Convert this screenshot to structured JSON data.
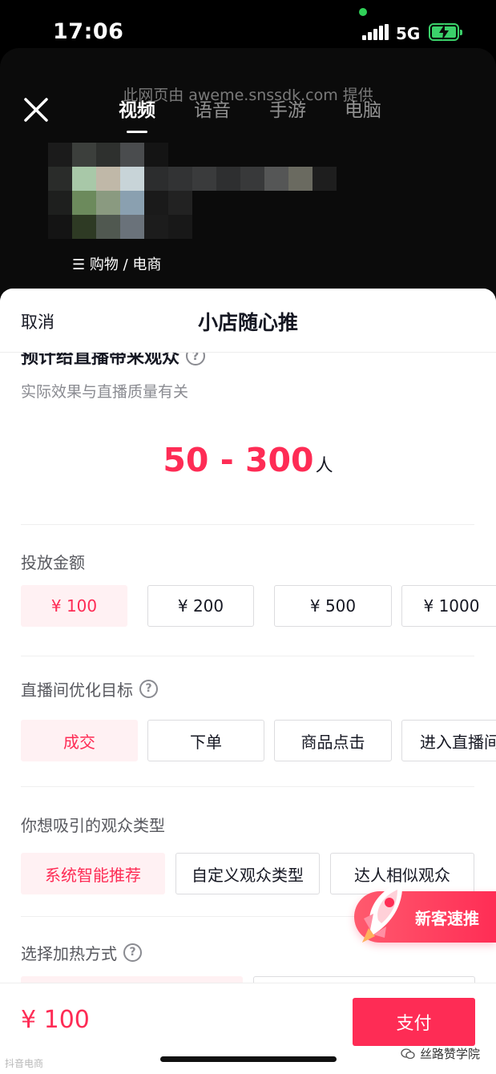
{
  "status_bar": {
    "time": "17:06",
    "network": "5G"
  },
  "header": {
    "provider": "此网页由 aweme.snssdk.com 提供",
    "tabs": [
      {
        "label": "视频",
        "active": true
      },
      {
        "label": "语音",
        "active": false
      },
      {
        "label": "手游",
        "active": false
      },
      {
        "label": "电脑",
        "active": false
      }
    ],
    "category": "☰ 购物 / 电商"
  },
  "sheet": {
    "cancel_label": "取消",
    "title": "小店随心推",
    "estimate": {
      "label": "预计给直播带来观众",
      "sub": "实际效果与直播质量有关",
      "value": "50 - 300",
      "unit": "人"
    },
    "budget": {
      "title": "投放金额",
      "options": [
        "¥ 100",
        "¥ 200",
        "¥ 500",
        "¥ 1000"
      ],
      "selected": "¥ 100"
    },
    "goal": {
      "title": "直播间优化目标",
      "options": [
        "成交",
        "下单",
        "商品点击",
        "进入直播间"
      ],
      "selected": "成交"
    },
    "audience": {
      "title": "你想吸引的观众类型",
      "options": [
        "系统智能推荐",
        "自定义观众类型",
        "达人相似观众"
      ],
      "selected": "系统智能推荐"
    },
    "heating": {
      "title": "选择加热方式"
    },
    "promo_label": "新客速推",
    "help_icon": "help-circle-icon"
  },
  "footer": {
    "price": "¥ 100",
    "pay_label": "支付",
    "watermark_left": "抖音电商",
    "watermark_right": "丝路赞学院"
  },
  "colors": {
    "accent": "#fe2c55",
    "selected_bg": "#fff1f3"
  }
}
